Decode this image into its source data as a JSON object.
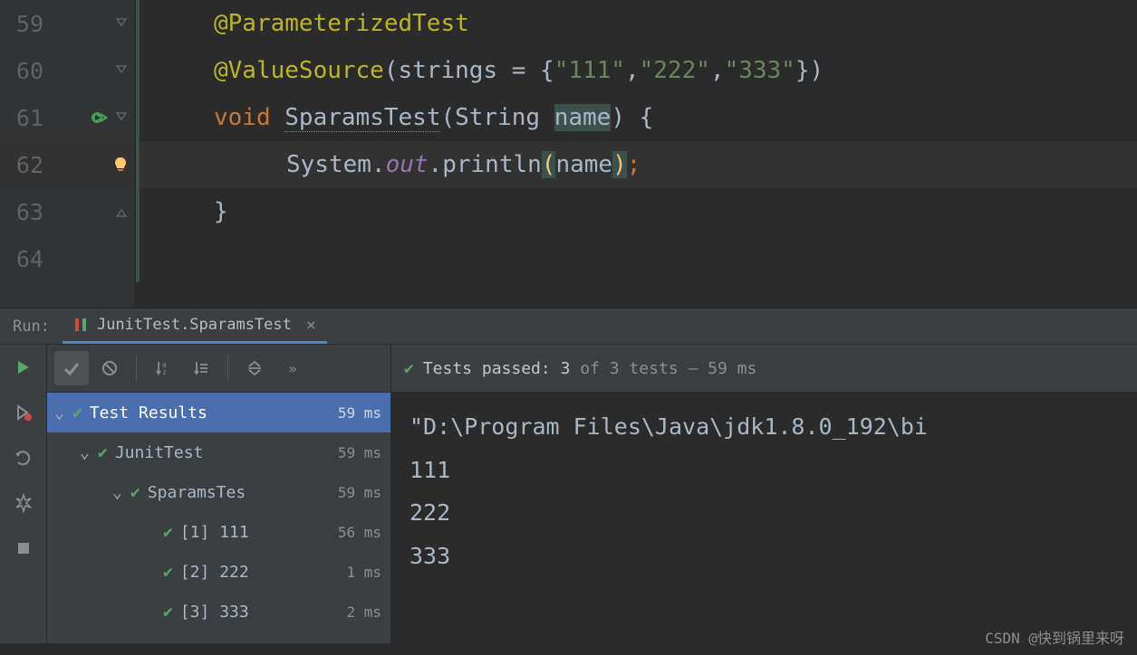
{
  "editor": {
    "lines": {
      "l59": "59",
      "l60": "60",
      "l61": "61",
      "l62": "62",
      "l63": "63",
      "l64": "64"
    },
    "code": {
      "ann1": "@ParameterizedTest",
      "ann2a": "@ValueSource",
      "ann2b": "(strings = {",
      "s1": "\"111\"",
      "c1": ",",
      "s2": "\"222\"",
      "c2": ",",
      "s3": "\"333\"",
      "ann2c": "})",
      "kw_void": "void ",
      "method": "SparamsTest",
      "sig_open": "(String ",
      "param": "name",
      "sig_close": ") {",
      "sys": "System.",
      "out": "out",
      "dot": ".",
      "println": "println",
      "po": "(",
      "arg": "name",
      "pc": ")",
      "semi": ";",
      "brace_close": "}"
    }
  },
  "run": {
    "label": "Run:",
    "tab": "JunitTest.SparamsTest",
    "status_pre": "Tests passed: ",
    "status_count": "3",
    "status_post": " of 3 tests – 59 ms",
    "tree": {
      "root": {
        "label": "Test Results",
        "time": "59 ms"
      },
      "class": {
        "label": "JunitTest",
        "time": "59 ms"
      },
      "method": {
        "label": "SparamsTes",
        "time": "59 ms"
      },
      "t1": {
        "label": "[1] 111",
        "time": "56 ms"
      },
      "t2": {
        "label": "[2] 222",
        "time": "1 ms"
      },
      "t3": {
        "label": "[3] 333",
        "time": "2 ms"
      }
    },
    "output": {
      "path": "\"D:\\Program Files\\Java\\jdk1.8.0_192\\bi",
      "l1": "111",
      "l2": "222",
      "l3": "333"
    }
  },
  "watermark": "CSDN @快到锅里来呀"
}
